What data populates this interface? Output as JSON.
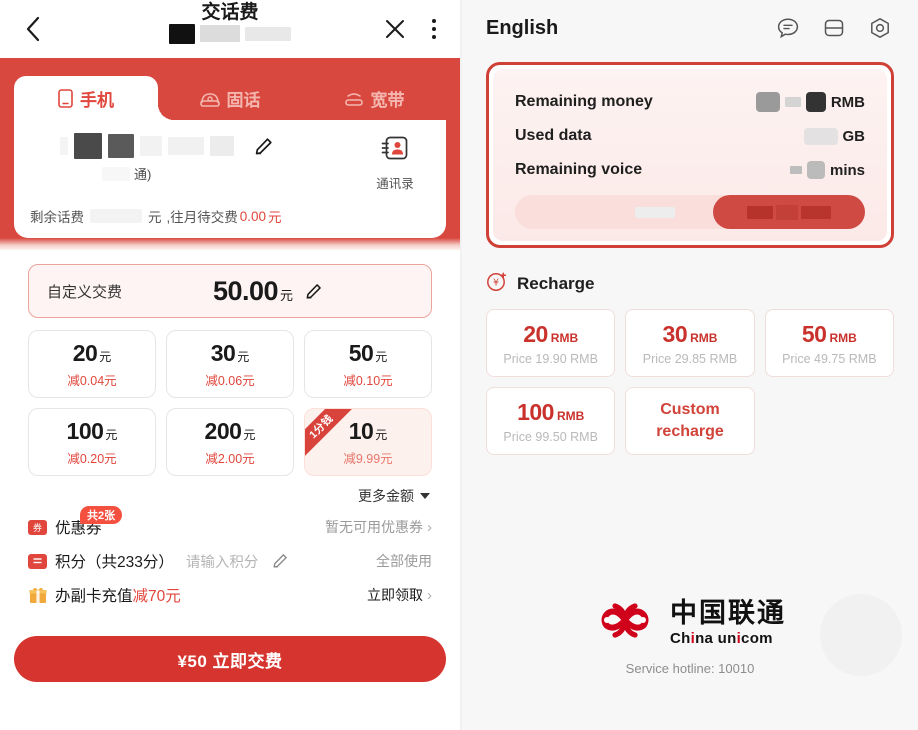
{
  "left": {
    "navbar": {
      "back_icon": "chevron-left-icon",
      "title": "交话费",
      "close_icon": "close-icon",
      "more_icon": "more-vertical-icon"
    },
    "tabs": [
      {
        "label": "手机",
        "icon": "mobile-icon",
        "active": true
      },
      {
        "label": "固话",
        "icon": "landline-icon",
        "active": false
      },
      {
        "label": "宽带",
        "icon": "broadband-icon",
        "active": false
      }
    ],
    "account": {
      "sub_text": "通)",
      "edit_icon": "pencil-icon",
      "contacts_icon": "contacts-card-icon",
      "contacts_label": "通讯录",
      "balance_prefix": "剩余话费",
      "balance_unit": "元",
      "balance_mid": ",往月待交费",
      "balance_due": "0.00",
      "balance_suffix": "元"
    },
    "custom_pay": {
      "label": "自定义交费",
      "value": "50.00",
      "unit": "元",
      "edit_icon": "pencil-icon"
    },
    "amounts": [
      {
        "value": "20",
        "unit": "元",
        "discount": "减0.04元",
        "promo": false,
        "ribbon": ""
      },
      {
        "value": "30",
        "unit": "元",
        "discount": "减0.06元",
        "promo": false,
        "ribbon": ""
      },
      {
        "value": "50",
        "unit": "元",
        "discount": "减0.10元",
        "promo": false,
        "ribbon": ""
      },
      {
        "value": "100",
        "unit": "元",
        "discount": "减0.20元",
        "promo": false,
        "ribbon": ""
      },
      {
        "value": "200",
        "unit": "元",
        "discount": "减2.00元",
        "promo": false,
        "ribbon": ""
      },
      {
        "value": "10",
        "unit": "元",
        "discount": "减9.99元",
        "promo": true,
        "ribbon": "1分钱"
      }
    ],
    "more_amount": "更多金额",
    "options": {
      "coupon": {
        "icon_glyph": "券",
        "label": "优惠券",
        "badge": "共2张",
        "status": "暂无可用优惠券",
        "chevron": "›"
      },
      "points": {
        "icon_glyph": "≡",
        "label": "积分（共233分）",
        "placeholder": "请输入积分",
        "edit_icon": "pencil-icon",
        "action": "全部使用"
      },
      "subcard": {
        "icon": "gift-icon",
        "label_prefix": "办副卡充值",
        "label_red": "减70元",
        "action": "立即领取",
        "chevron": "›"
      }
    },
    "pay_button": "¥50 立即交费"
  },
  "right": {
    "navbar": {
      "title": "English",
      "icons": [
        {
          "name": "chat-icon"
        },
        {
          "name": "split-screen-icon"
        },
        {
          "name": "settings-hex-icon"
        }
      ]
    },
    "info_card": {
      "rows": [
        {
          "label": "Remaining money",
          "unit": "RMB",
          "redacted": true
        },
        {
          "label": "Used data",
          "unit": "GB",
          "redacted": true
        },
        {
          "label": "Remaining voice",
          "unit": "mins",
          "redacted": true
        }
      ],
      "bottom_bar": {
        "redacted_label": true,
        "button_redacted": true
      }
    },
    "recharge": {
      "icon": "recharge-icon",
      "title": "Recharge",
      "items": [
        {
          "value": "20",
          "unit": "RMB",
          "price": "Price 19.90 RMB",
          "custom": false
        },
        {
          "value": "30",
          "unit": "RMB",
          "price": "Price 29.85 RMB",
          "custom": false
        },
        {
          "value": "50",
          "unit": "RMB",
          "price": "Price 49.75 RMB",
          "custom": false
        },
        {
          "value": "100",
          "unit": "RMB",
          "price": "Price 99.50 RMB",
          "custom": false
        },
        {
          "value": "",
          "unit": "",
          "price": "",
          "custom": true,
          "custom_label": "Custom recharge"
        }
      ]
    },
    "brand": {
      "logo": "china-unicom-logo",
      "name_cn": "中国联通",
      "name_en_parts": [
        "Ch",
        "i",
        "na un",
        "i",
        "com"
      ],
      "hotline": "Service hotline: 10010"
    }
  },
  "colors": {
    "brand_red": "#d9483f",
    "deep_red": "#c9322c",
    "pay_button": "#d6342e",
    "muted": "#9a9a9a"
  }
}
